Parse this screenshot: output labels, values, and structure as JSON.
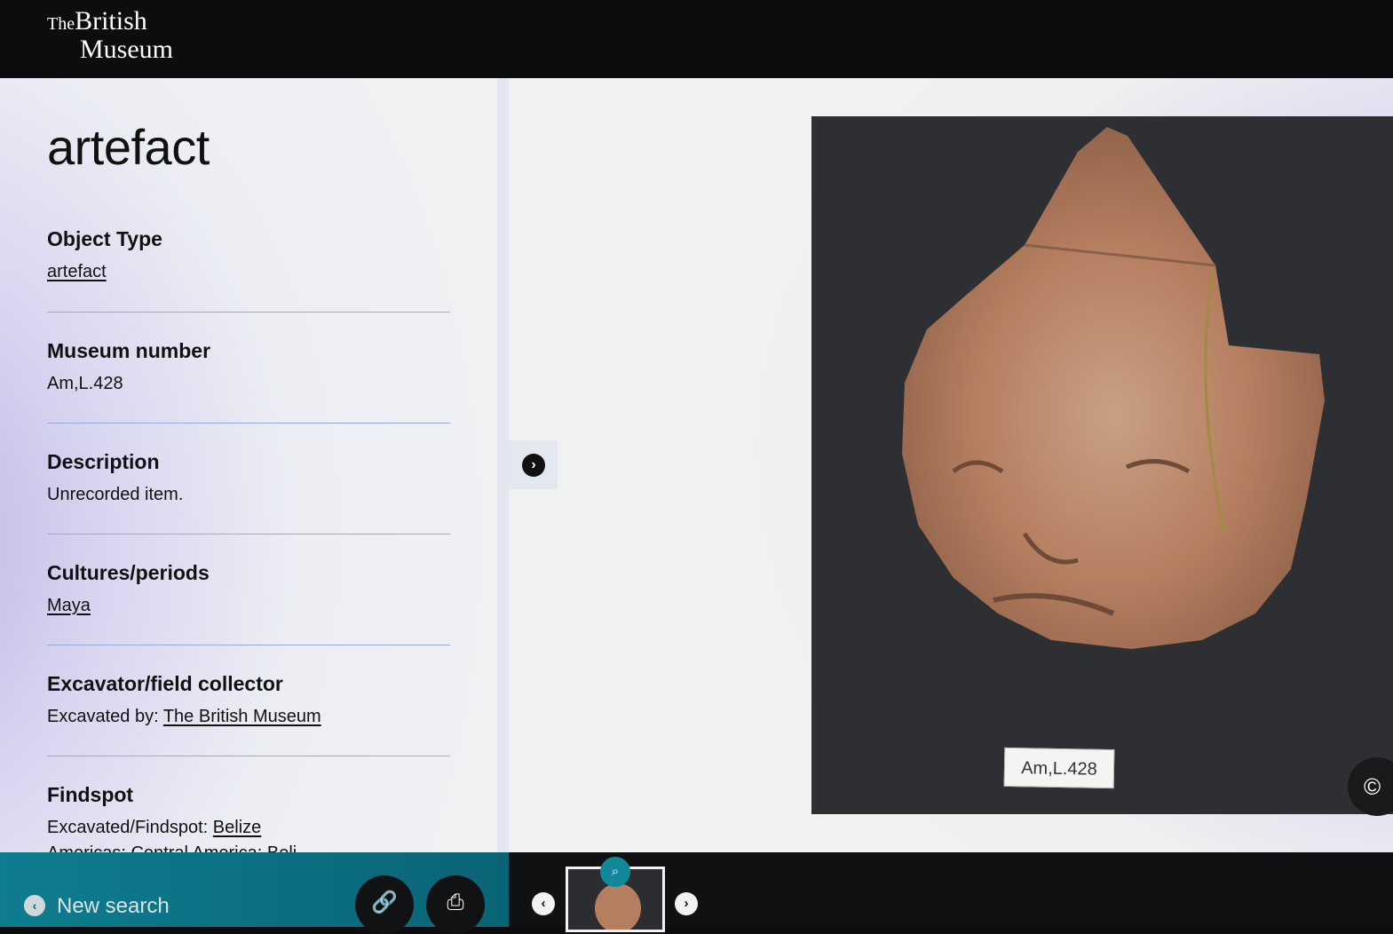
{
  "header": {
    "logo_the": "The",
    "logo_line1": "British",
    "logo_line2": "Museum"
  },
  "record": {
    "title": "artefact",
    "fields": [
      {
        "label": "Object Type",
        "value": "artefact"
      },
      {
        "label": "Museum number",
        "value": "Am,L.428"
      },
      {
        "label": "Description",
        "value": "Unrecorded item."
      },
      {
        "label": "Cultures/periods",
        "value": "Maya"
      },
      {
        "label": "Excavator/field collector",
        "prefix": "Excavated by: ",
        "value": "The British Museum"
      },
      {
        "label": "Findspot",
        "prefix": "Excavated/Findspot: ",
        "value": "Belize",
        "overflow": "Americas: Central America: Beli"
      }
    ]
  },
  "image": {
    "tag_text": "Am,L.428",
    "copyright_symbol": "©"
  },
  "footer": {
    "new_search_label": "New search"
  },
  "icons": {
    "expand": "chevron-right-icon",
    "back": "chevron-left-icon",
    "link": "link-icon",
    "print": "printer-icon",
    "zoom": "magnifier-icon",
    "prev": "chevron-left-icon",
    "next": "chevron-right-icon"
  },
  "colors": {
    "teal": "#0e7d8f",
    "zoom_badge": "#12889b"
  }
}
